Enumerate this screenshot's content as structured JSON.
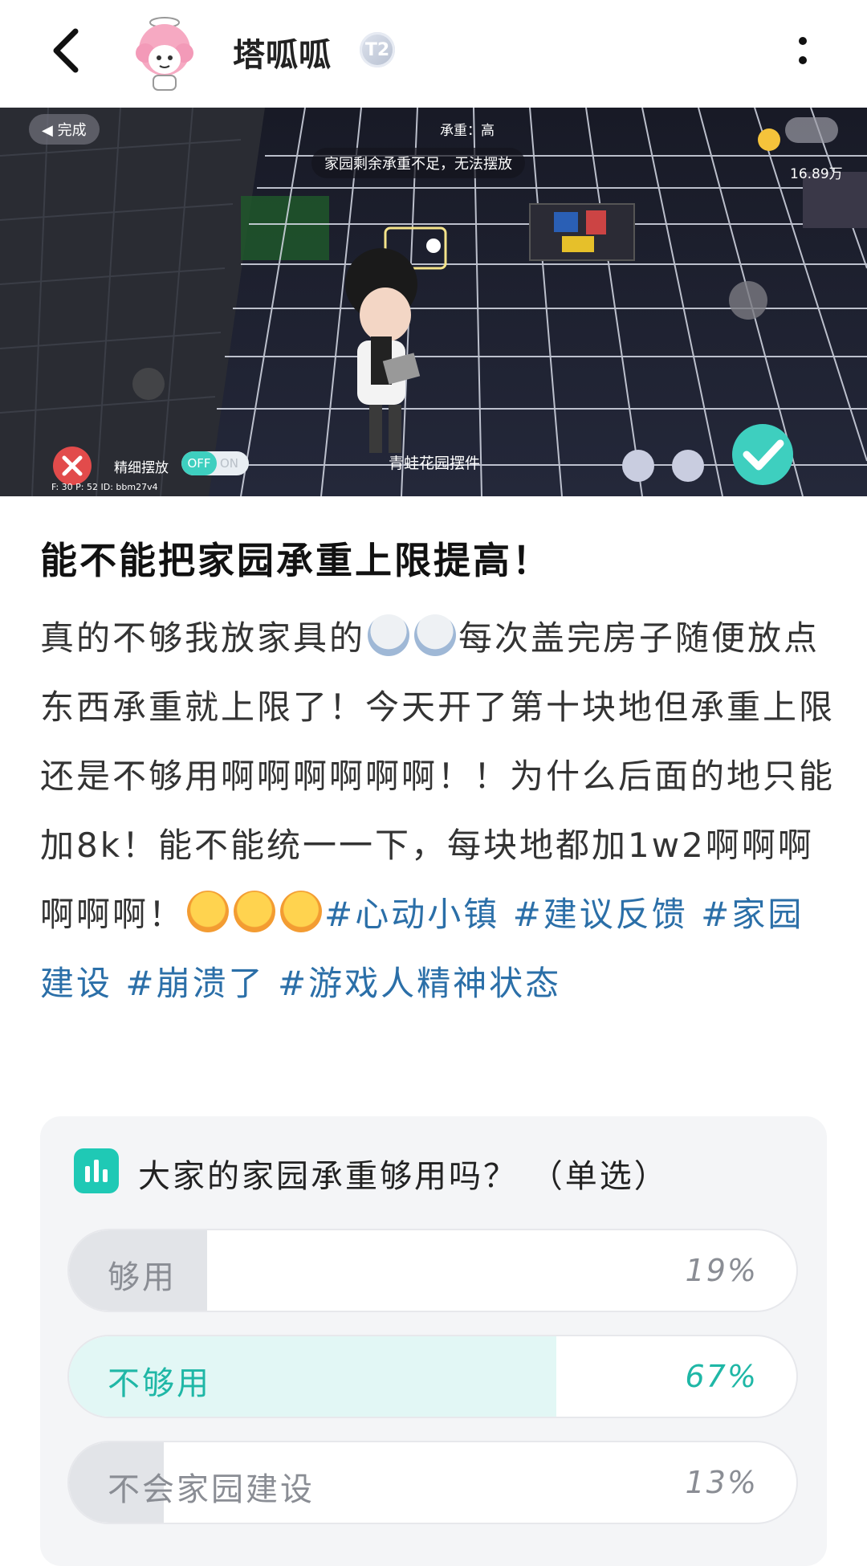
{
  "header": {
    "username": "塔呱呱",
    "badge": "T2",
    "icons": {
      "back": "chevron-left-icon",
      "more": "more-vertical-icon"
    }
  },
  "game_screenshot": {
    "done_button": "完成",
    "load_label": "承重：高",
    "warning": "家园剩余承重不足，无法摆放",
    "coins": "16.89万",
    "fine_place_label": "精细摆放",
    "toggle_off": "OFF",
    "toggle_on": "ON",
    "item_name": "青蛙花园摆件",
    "coords": "F: 30   P: 52   ID: bbm27v4"
  },
  "post": {
    "title": "能不能把家园承重上限提高！",
    "body_1": "真的不够我放家具的",
    "body_2": "每次盖完房子随便放点东西承重就上限了！今天开了第十块地但承重上限还是不够用啊啊啊啊啊啊！！为什么后面的地只能加8k！能不能统一一下，每块地都加1w2啊啊啊啊啊啊！",
    "tags": [
      "#心动小镇",
      "#建议反馈",
      "#家园建设",
      "#崩溃了",
      "#游戏人精神状态"
    ]
  },
  "poll": {
    "question": "大家的家园承重够用吗？ （单选）",
    "options": [
      {
        "label": "够用",
        "percent_text": "19%",
        "percent": 19,
        "selected": false
      },
      {
        "label": "不够用",
        "percent_text": "67%",
        "percent": 67,
        "selected": true
      },
      {
        "label": "不会家园建设",
        "percent_text": "13%",
        "percent": 13,
        "selected": false
      }
    ]
  },
  "colors": {
    "accent": "#1fc9b5",
    "tag": "#2b6fa8",
    "poll_bg": "#f4f5f7"
  }
}
